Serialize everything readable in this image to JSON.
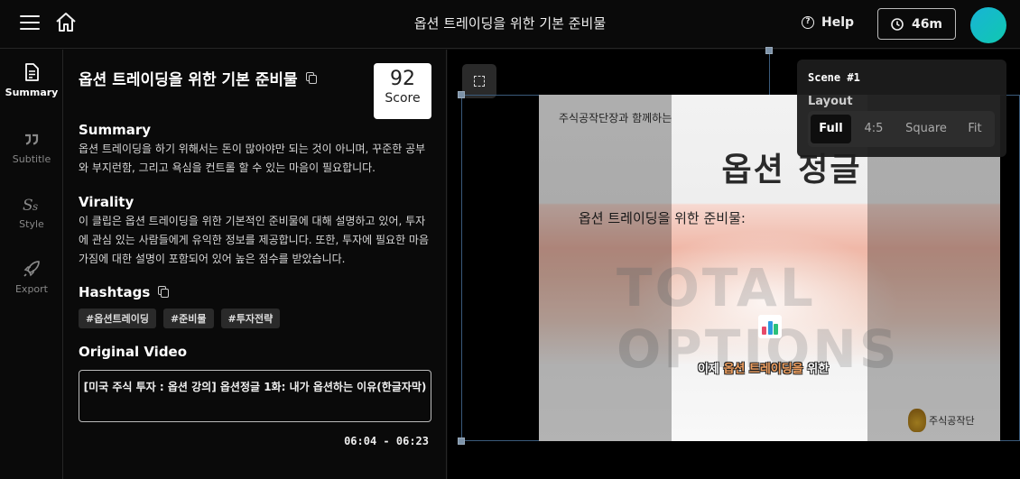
{
  "header": {
    "title": "옵션 트레이딩을 위한 기본 준비물",
    "help_label": "Help",
    "timer_label": "46m"
  },
  "sidebar": {
    "items": [
      {
        "label": "Summary",
        "icon": "document-icon",
        "active": true
      },
      {
        "label": "Subtitle",
        "icon": "quote-icon",
        "active": false
      },
      {
        "label": "Style",
        "icon": "style-icon",
        "active": false
      },
      {
        "label": "Export",
        "icon": "rocket-icon",
        "active": false
      }
    ]
  },
  "panel": {
    "title": "옵션 트레이딩을 위한 기본 준비물",
    "score_value": "92",
    "score_label": "Score",
    "summary_heading": "Summary",
    "summary_text": "옵션 트레이딩을 하기 위해서는 돈이 많아야만 되는 것이 아니며, 꾸준한 공부와 부지런함, 그리고 욕심을 컨트롤 할 수 있는 마음이 필요합니다.",
    "virality_heading": "Virality",
    "virality_text": "이 클립은 옵션 트레이딩을 위한 기본적인 준비물에 대해 설명하고 있어, 투자에 관심 있는 사람들에게 유익한 정보를 제공합니다. 또한, 투자에 필요한 마음가짐에 대한 설명이 포함되어 있어 높은 점수를 받았습니다.",
    "hashtags_heading": "Hashtags",
    "hashtags": [
      "#옵션트레이딩",
      "#준비물",
      "#투자전략"
    ],
    "original_heading": "Original Video",
    "original_title": "[미국 주식 투자 : 옵션 강의] 옵션정글 1화: 내가 옵션하는 이유(한글자막)",
    "time_range": "06:04 - 06:23"
  },
  "video": {
    "small_text": "주식공작단장과 함께하는",
    "big_title": "옵션 정글",
    "subtitle_line": "옵션 트레이딩을 위한 준비물:",
    "watermark": "TOTAL OPTIONS",
    "caption_pre": "이제 ",
    "caption_highlight": "옵션 트레이딩을",
    "caption_post": " 위한",
    "logo_text": "주식공작단"
  },
  "scene": {
    "title": "Scene #1",
    "layout_label": "Layout",
    "options": [
      "Full",
      "4:5",
      "Square",
      "Fit"
    ],
    "selected": "Full"
  },
  "colors": {
    "background": "#0a0a0a",
    "avatar": "#18b4d6",
    "caption_highlight": "#f0a060"
  }
}
